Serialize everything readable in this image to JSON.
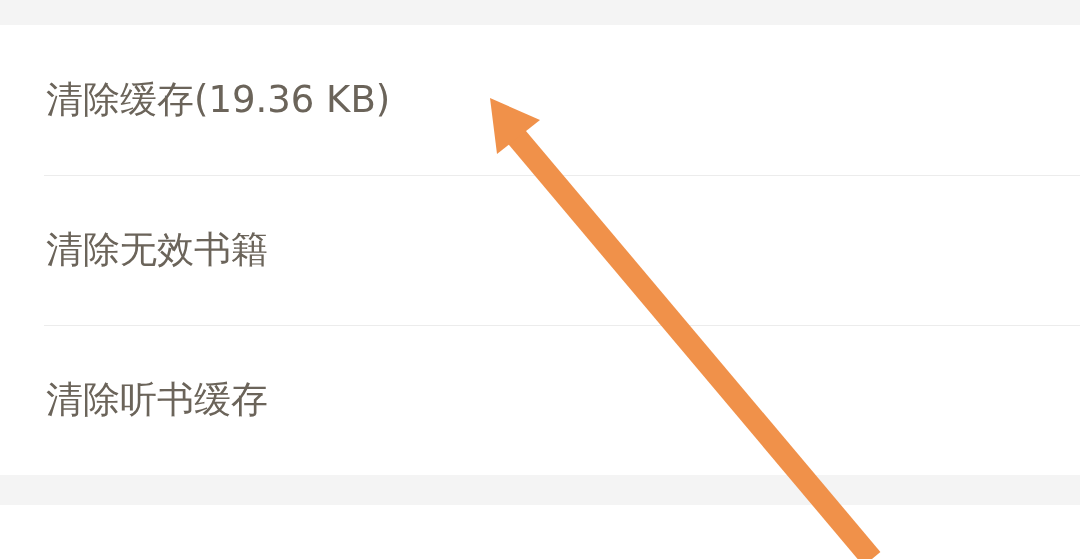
{
  "settings": {
    "items": [
      {
        "label": "清除缓存(19.36 KB)"
      },
      {
        "label": "清除无效书籍"
      },
      {
        "label": "清除听书缓存"
      }
    ]
  }
}
